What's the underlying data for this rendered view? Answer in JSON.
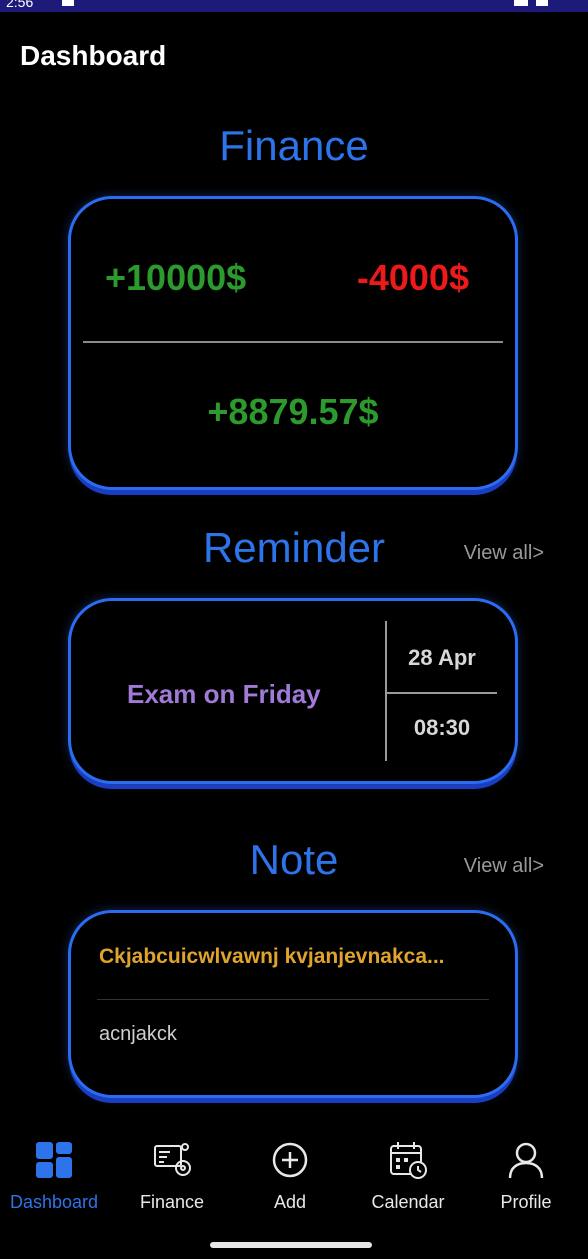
{
  "status": {
    "time": "2:56"
  },
  "header": {
    "title": "Dashboard"
  },
  "finance": {
    "title": "Finance",
    "income": "+10000$",
    "expense": "-4000$",
    "balance": "+8879.57$"
  },
  "reminder": {
    "title": "Reminder",
    "view_all": "View all>",
    "item": {
      "text": "Exam on Friday",
      "date": "28 Apr",
      "time": "08:30"
    }
  },
  "note": {
    "title": "Note",
    "view_all": "View all>",
    "item": {
      "title": "Ckjabcuicwlvawnj kvjanjevnakca...",
      "body": "acnjakck"
    }
  },
  "nav": {
    "items": [
      {
        "label": "Dashboard",
        "icon": "dashboard-icon",
        "active": true
      },
      {
        "label": "Finance",
        "icon": "finance-icon",
        "active": false
      },
      {
        "label": "Add",
        "icon": "add-icon",
        "active": false
      },
      {
        "label": "Calendar",
        "icon": "calendar-icon",
        "active": false
      },
      {
        "label": "Profile",
        "icon": "profile-icon",
        "active": false
      }
    ]
  },
  "colors": {
    "accent": "#2d74ea",
    "income": "#2c9a2c",
    "expense": "#ee1a1a",
    "reminder_text": "#a07ad6",
    "note_title": "#e0a32c"
  }
}
